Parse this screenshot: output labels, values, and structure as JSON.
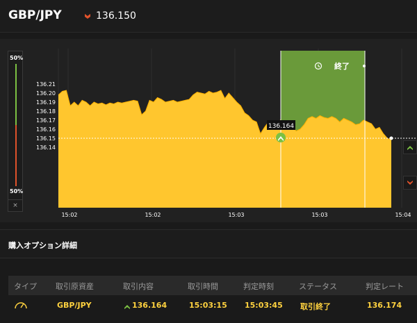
{
  "header": {
    "pair": "GBP/JPY",
    "price": "136.150",
    "price_direction": "down",
    "down_color": "#e0522b"
  },
  "gauge": {
    "top_label": "50%",
    "bottom_label": "50%",
    "close_label": "×",
    "up_color": "#7cc143",
    "down_color": "#e0522b"
  },
  "chart": {
    "expiry_label": "終了",
    "marker_label": "136.164",
    "fill_color": "#ffc62e",
    "window_color": "#6a9a3a"
  },
  "chart_data": {
    "type": "area",
    "y_ticks": [
      "136.21",
      "136.20",
      "136.19",
      "136.18",
      "136.17",
      "136.16",
      "136.15",
      "136.14"
    ],
    "x_ticks": [
      "15:02",
      "15:02",
      "15:03",
      "15:03",
      "15:04"
    ],
    "ylim": [
      136.13,
      136.215
    ],
    "current_price": 136.15,
    "entry_price": 136.164,
    "series": [
      {
        "values": [
          136.198,
          136.202,
          136.203,
          136.186,
          136.19,
          136.186,
          136.192,
          136.19,
          136.186,
          136.19,
          136.188,
          136.189,
          136.187,
          136.189,
          136.188,
          136.19,
          136.189,
          136.19,
          136.191,
          136.192,
          136.191,
          136.176,
          136.18,
          136.192,
          136.19,
          136.195,
          136.193,
          136.19,
          136.191,
          136.192,
          136.19,
          136.191,
          136.192,
          136.193,
          136.198,
          136.201,
          136.2,
          136.199,
          136.202,
          136.2,
          136.201,
          136.203,
          136.194,
          136.2,
          136.195,
          136.19,
          136.186,
          136.178,
          136.175,
          136.17,
          136.168,
          136.155,
          136.162,
          136.168,
          136.166,
          136.16,
          136.17,
          136.165,
          136.16,
          136.163,
          136.158,
          136.16,
          136.165,
          136.172,
          136.174,
          136.172,
          136.175,
          136.173,
          136.172,
          136.174,
          136.172,
          136.168,
          136.172,
          136.17,
          136.168,
          136.165,
          136.166,
          136.17,
          136.168,
          136.166,
          136.16,
          136.162,
          136.155,
          136.15,
          136.148
        ]
      }
    ]
  },
  "details": {
    "title": "購入オプション詳細",
    "columns": [
      "タイプ",
      "取引原資産",
      "取引内容",
      "取引時間",
      "判定時刻",
      "ステータス",
      "判定レート"
    ],
    "row": {
      "type_icon": "gauge-icon",
      "asset": "GBP/JPY",
      "content": "136.164",
      "direction": "up",
      "trade_time": "15:03:15",
      "judge_time": "15:03:45",
      "status": "取引終了",
      "rate": "136.174"
    }
  }
}
